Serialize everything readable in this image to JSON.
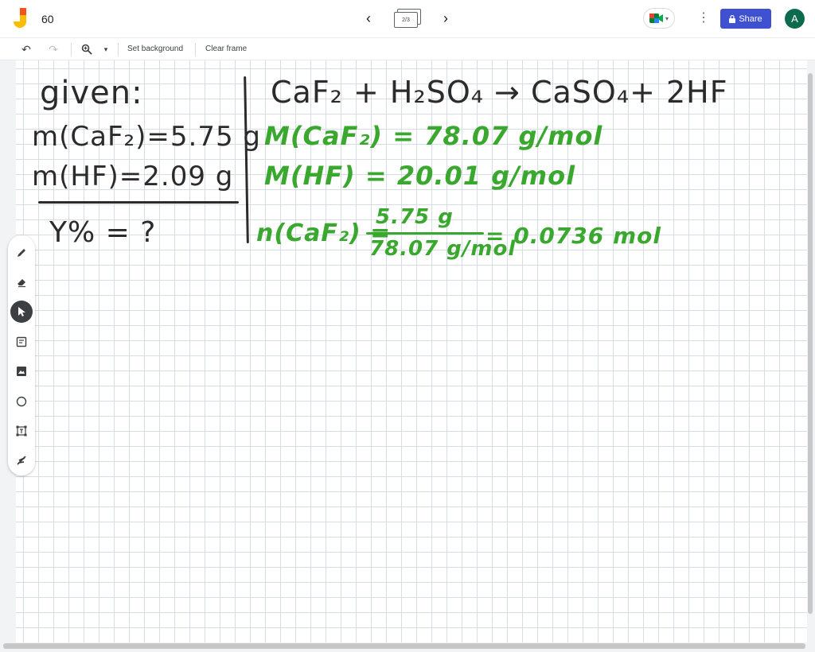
{
  "header": {
    "title": "60",
    "frame_indicator": "2/3",
    "share_label": "Share",
    "avatar_initial": "A"
  },
  "toolbar": {
    "set_background": "Set background",
    "clear_frame": "Clear frame"
  },
  "board": {
    "given_label": "given:",
    "mass_caf2": "m(CaF₂)=5.75 g",
    "mass_hf": "m(HF)=2.09 g",
    "yield_question": "Y% = ?",
    "equation": "CaF₂ + H₂SO₄ → CaSO₄+ 2HF",
    "molar_caf2": "M(CaF₂) = 78.07 g/mol",
    "molar_hf": "M(HF) = 20.01 g/mol",
    "moles_lhs": "n(CaF₂) =",
    "moles_numerator": "5.75 g",
    "moles_denominator": "78.07 g/mol",
    "moles_result": "= 0.0736 mol"
  },
  "colors": {
    "ink_black": "#2b2b2b",
    "ink_green": "#3aa82f",
    "share_button": "#3f51d0",
    "avatar": "#0b6b4c"
  },
  "icons": [
    "jamboard-logo",
    "prev-frame-icon",
    "next-frame-icon",
    "meet-icon",
    "more-vert-icon",
    "lock-icon",
    "undo-icon",
    "redo-icon",
    "zoom-icon",
    "pen-icon",
    "eraser-icon",
    "select-icon",
    "sticky-note-icon",
    "image-icon",
    "circle-shape-icon",
    "text-box-icon",
    "laser-icon"
  ]
}
